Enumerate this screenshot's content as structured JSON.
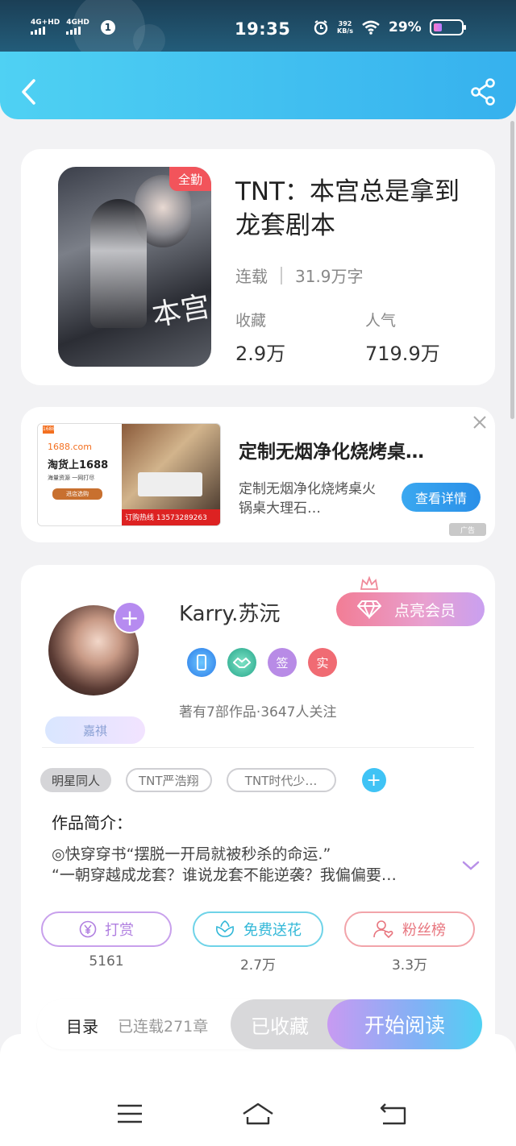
{
  "status_bar": {
    "net1": "4G+HD",
    "net2": "4GHD",
    "sim": "1",
    "time": "19:35",
    "speed_value": "392",
    "speed_unit": "KB/s",
    "battery_text": "29%",
    "battery_level": 0.29
  },
  "header": {
    "back_icon": "chevron-left-icon",
    "share_icon": "share-icon"
  },
  "book": {
    "cover_badge": "全勤",
    "title": "TNT：本宫总是拿到龙套剧本",
    "status": "连载",
    "word_count": "31.9万字",
    "favorites_label": "收藏",
    "favorites_value": "2.9万",
    "popularity_label": "人气",
    "popularity_value": "719.9万"
  },
  "ad": {
    "image_logo": "1688",
    "image_line1": "1688.com",
    "image_line2": "淘货上1688",
    "image_line3": "海量资源 一网打尽",
    "image_btn": "进店选购",
    "image_phone": "订购热线 13573289263",
    "title": "定制无烟净化烧烤桌…",
    "description": "定制无烟净化烧烤桌火锅桌大理石…",
    "cta": "查看详情",
    "mark": "广告"
  },
  "author": {
    "name": "Karry.苏沅",
    "vip_label": "点亮会员",
    "badges": [
      "phone-badge-icon",
      "handshake-badge-icon",
      "签",
      "实"
    ],
    "stats": "著有7部作品·3647人关注",
    "name_tag": "嘉祺",
    "tags": [
      "明星同人",
      "TNT严浩翔",
      "TNT时代少…"
    ],
    "intro_title": "作品简介：",
    "intro_line1": "◎快穿穿书“摆脱一开局就被秒杀的命运.”",
    "intro_line2": "“一朝穿越成龙套？谁说龙套不能逆袭？我偏偏要…",
    "actions": [
      {
        "label": "打赏",
        "count": "5161",
        "icon": "yen-icon"
      },
      {
        "label": "免费送花",
        "count": "2.7万",
        "icon": "flower-icon"
      },
      {
        "label": "粉丝榜",
        "count": "3.3万",
        "icon": "user-heart-icon"
      }
    ]
  },
  "bottom_bar": {
    "toc_label": "目录",
    "toc_count": "已连载271章",
    "collected_label": "已收藏",
    "read_label": "开始阅读"
  },
  "nav": {
    "menu_icon": "menu-icon",
    "home_icon": "home-icon",
    "back_icon": "back-icon"
  }
}
